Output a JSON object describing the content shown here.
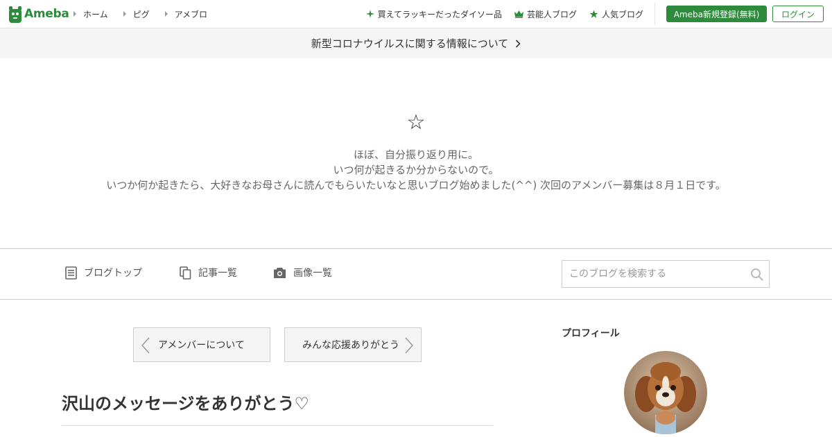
{
  "header": {
    "logo_text": "Ameba",
    "nav": [
      {
        "label": "ホーム"
      },
      {
        "label": "ピグ"
      },
      {
        "label": "アメブロ"
      }
    ],
    "right_links": [
      {
        "label": "買えてラッキーだったダイソー品",
        "icon": "sparkle-icon"
      },
      {
        "label": "芸能人ブログ",
        "icon": "crown-icon"
      },
      {
        "label": "人気ブログ",
        "icon": "star-icon"
      }
    ],
    "register_label": "Ameba新規登録(無料)",
    "login_label": "ログイン",
    "accent_color": "#2d8c3c"
  },
  "notice": {
    "text": "新型コロナウイルスに関する情報について"
  },
  "blog": {
    "symbol": "☆",
    "description_lines": [
      "ほぼ、自分振り返り用に。",
      "いつ何が起きるか分からないので。",
      "いつか何か起きたら、大好きなお母さんに読んでもらいたいなと思いブログ始めました(^^) 次回のアメンバー募集は８月１日です。"
    ]
  },
  "menu": {
    "items": [
      {
        "label": "ブログトップ",
        "icon": "document-icon"
      },
      {
        "label": "記事一覧",
        "icon": "copy-icon"
      },
      {
        "label": "画像一覧",
        "icon": "camera-icon"
      }
    ],
    "search_placeholder": "このブログを検索する"
  },
  "article": {
    "prev_label": "アメンバーについて",
    "next_label": "みんな応援ありがとう",
    "title": "沢山のメッセージをありがとう♡"
  },
  "sidebar": {
    "profile_title": "プロフィール"
  }
}
